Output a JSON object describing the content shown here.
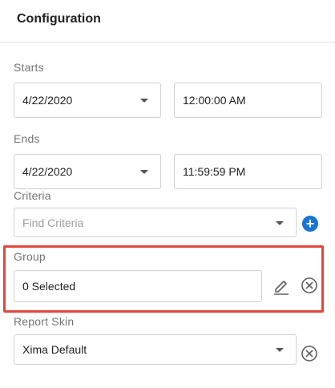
{
  "header": {
    "title": "Configuration"
  },
  "starts": {
    "label": "Starts",
    "date": "4/22/2020",
    "time": "12:00:00 AM"
  },
  "ends": {
    "label": "Ends",
    "date": "4/22/2020",
    "time": "11:59:59 PM"
  },
  "criteria": {
    "label": "Criteria",
    "placeholder": "Find Criteria",
    "add_icon": "plus-circle-icon"
  },
  "group": {
    "label": "Group",
    "value": "0 Selected",
    "edit_icon": "pencil-icon",
    "clear_icon": "close-circle-icon"
  },
  "report_skin": {
    "label": "Report Skin",
    "value": "Xima Default",
    "clear_icon": "close-circle-icon"
  },
  "colors": {
    "accent": "#1976d2",
    "highlight": "#e0483e",
    "border": "#d0d0d0",
    "label": "#757575"
  }
}
